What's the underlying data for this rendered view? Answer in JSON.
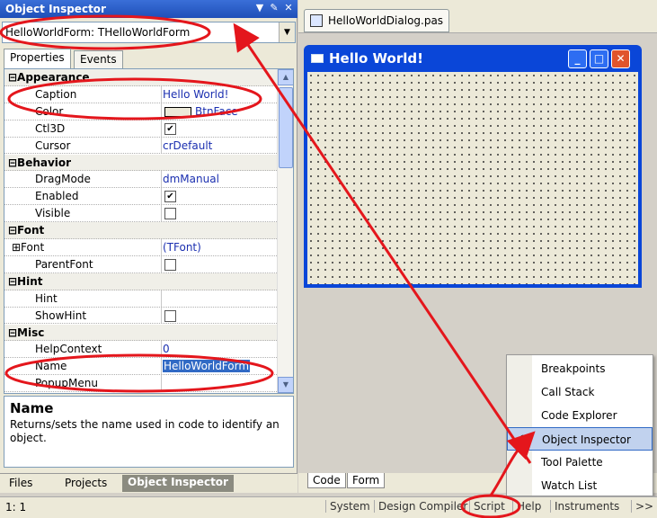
{
  "object_inspector": {
    "title": "Object Inspector",
    "selector_value": "HelloWorldForm: THelloWorldForm",
    "tabs": [
      "Properties",
      "Events"
    ],
    "properties": [
      {
        "kind": "cat",
        "name": "Appearance"
      },
      {
        "kind": "prop",
        "name": "Caption",
        "value": "Hello World!"
      },
      {
        "kind": "prop",
        "name": "Color",
        "value": "BtnFace",
        "swatch": true
      },
      {
        "kind": "prop",
        "name": "Ctl3D",
        "checked": true
      },
      {
        "kind": "prop",
        "name": "Cursor",
        "value": "crDefault"
      },
      {
        "kind": "cat",
        "name": "Behavior"
      },
      {
        "kind": "prop",
        "name": "DragMode",
        "value": "dmManual"
      },
      {
        "kind": "prop",
        "name": "Enabled",
        "checked": true
      },
      {
        "kind": "prop",
        "name": "Visible",
        "checked": false
      },
      {
        "kind": "cat",
        "name": "Font"
      },
      {
        "kind": "sub",
        "name": "Font",
        "value": "(TFont)"
      },
      {
        "kind": "prop",
        "name": "ParentFont",
        "checked": false
      },
      {
        "kind": "cat",
        "name": "Hint"
      },
      {
        "kind": "prop",
        "name": "Hint",
        "value": ""
      },
      {
        "kind": "prop",
        "name": "ShowHint",
        "checked": false
      },
      {
        "kind": "cat",
        "name": "Misc"
      },
      {
        "kind": "prop",
        "name": "HelpContext",
        "value": "0"
      },
      {
        "kind": "prop",
        "name": "Name",
        "value": "HelloWorldForm",
        "selected": true
      },
      {
        "kind": "prop",
        "name": "PopupMenu",
        "value": ""
      }
    ],
    "help_title": "Name",
    "help_text": "Returns/sets the name used in code to identify an object.",
    "bottom_tabs": [
      "Files",
      "Projects",
      "Object Inspector"
    ]
  },
  "designer": {
    "file_tab": "HelloWorldDialog.pas",
    "form_caption": "Hello World!",
    "code_tabs": [
      "Code",
      "Form"
    ]
  },
  "menu": {
    "items": [
      {
        "label": "Breakpoints",
        "checked": false
      },
      {
        "label": "Call Stack",
        "checked": false
      },
      {
        "label": "Code Explorer",
        "checked": false
      },
      {
        "label": "Object Inspector",
        "checked": true
      },
      {
        "label": "Tool Palette",
        "checked": false
      },
      {
        "label": "Watch List",
        "checked": false
      }
    ]
  },
  "status": {
    "position": "1: 1",
    "buttons": [
      "System",
      "Design Compiler",
      "Script",
      "Help",
      "Instruments",
      ">>"
    ]
  },
  "colors": {
    "title_blue": "#1f4fb8",
    "annotation_red": "#e4161c",
    "selection": "#316ac5"
  }
}
